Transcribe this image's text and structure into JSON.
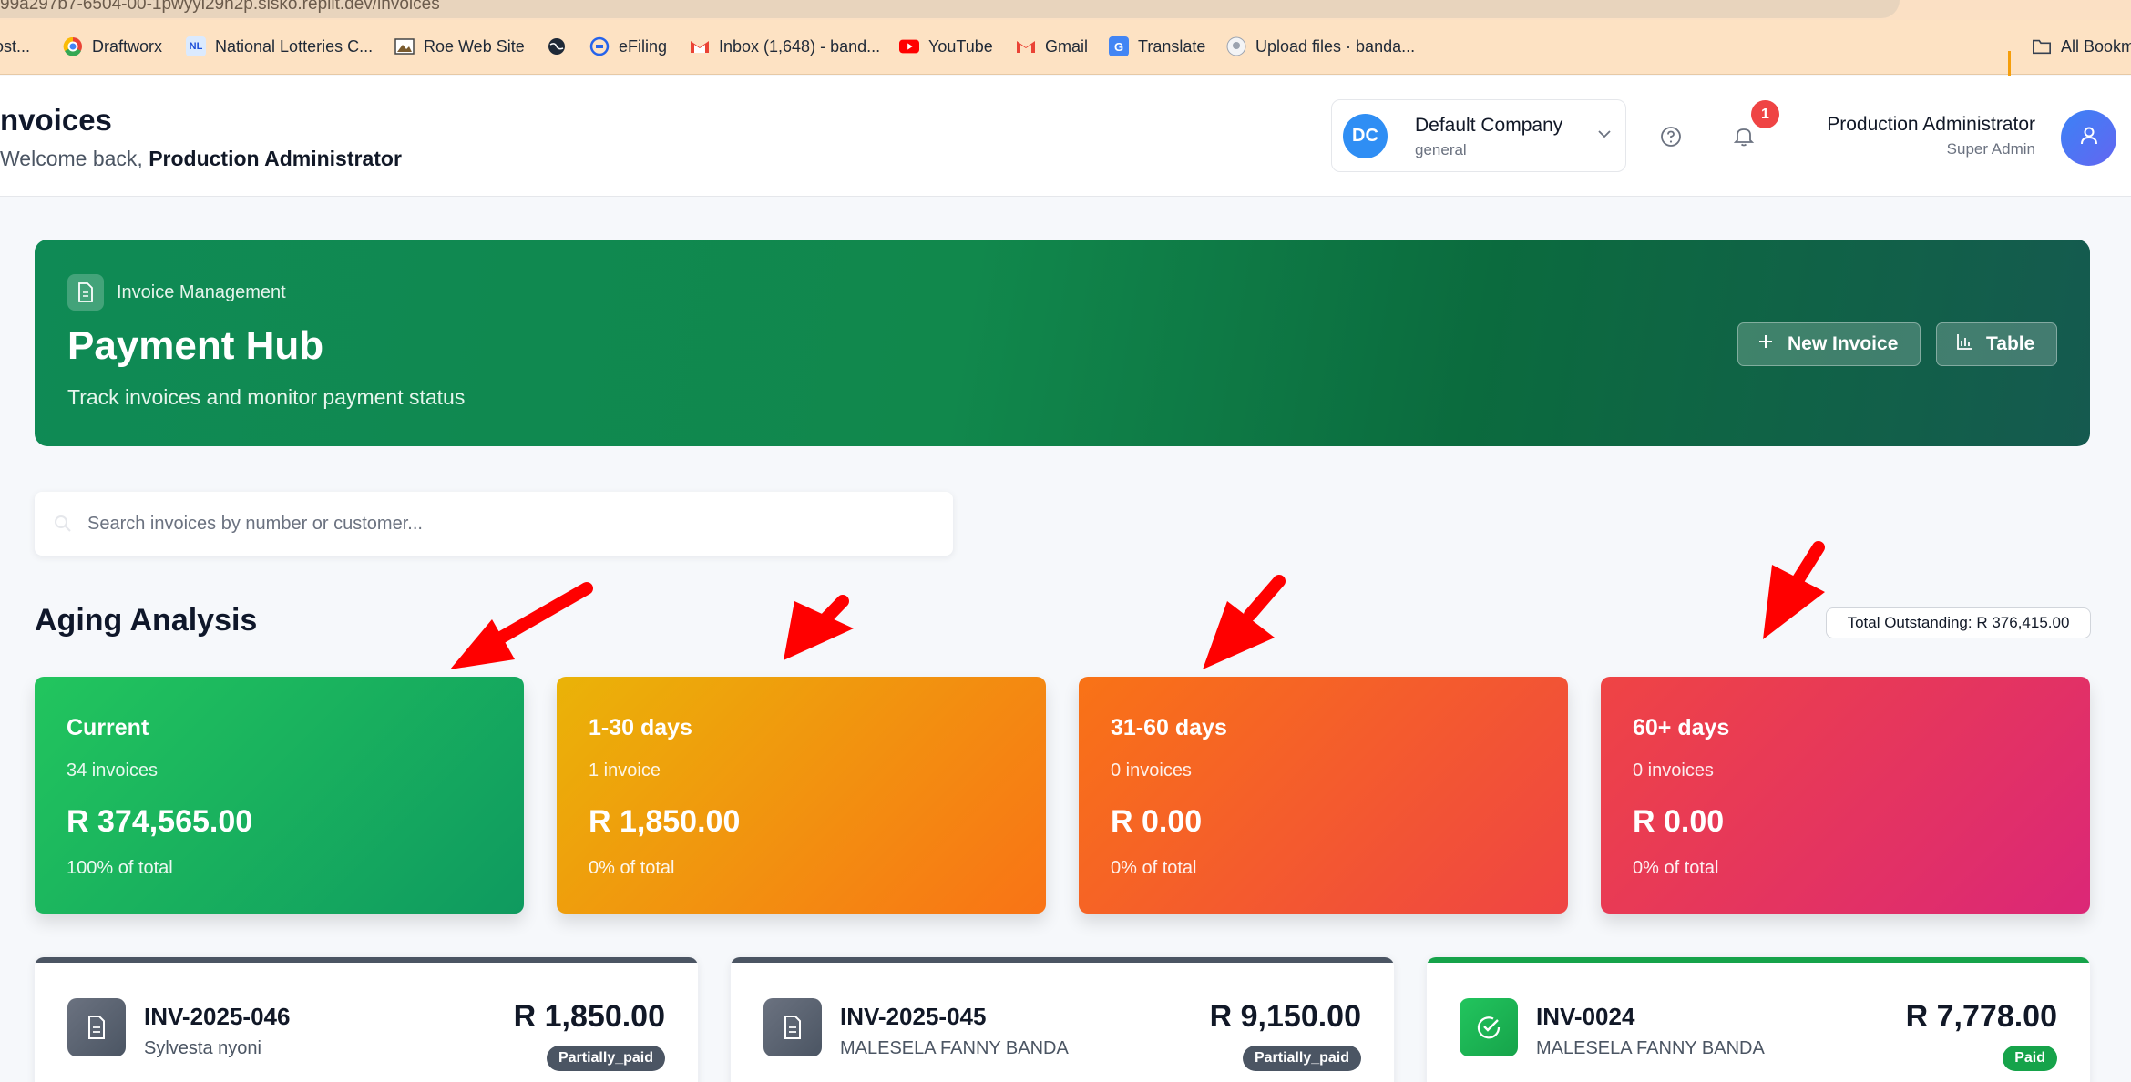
{
  "browser": {
    "url": "99a297b7-6504-00-1pwyyl29h2p.sisko.replit.dev/invoices",
    "bookmarks": [
      {
        "label": "ost...",
        "icon": "bookmark-icon"
      },
      {
        "label": "Draftworx",
        "icon": "chrome-icon"
      },
      {
        "label": "National Lotteries C...",
        "icon": "lotteries-icon"
      },
      {
        "label": "Roe Web Site",
        "icon": "picture-icon"
      },
      {
        "label": "",
        "icon": "globe-icon"
      },
      {
        "label": "eFiling",
        "icon": "efiling-icon"
      },
      {
        "label": "Inbox (1,648) - band...",
        "icon": "gmail-icon"
      },
      {
        "label": "YouTube",
        "icon": "youtube-icon"
      },
      {
        "label": "Gmail",
        "icon": "gmail-icon"
      },
      {
        "label": "Translate",
        "icon": "translate-icon"
      },
      {
        "label": "Upload files · banda...",
        "icon": "github-icon"
      }
    ],
    "all_bookmarks": "All Bookm"
  },
  "header": {
    "title": "nvoices",
    "welcome_prefix": "Welcome back, ",
    "welcome_user": "Production Administrator",
    "company": {
      "initials": "DC",
      "name": "Default Company",
      "sub": "general"
    },
    "notifications": "1",
    "user": {
      "name": "Production Administrator",
      "role": "Super Admin"
    }
  },
  "hero": {
    "tag": "Invoice Management",
    "title": "Payment Hub",
    "subtitle": "Track invoices and monitor payment status",
    "new_invoice": "New Invoice",
    "table": "Table"
  },
  "search": {
    "placeholder": "Search invoices by number or customer..."
  },
  "aging": {
    "title": "Aging Analysis",
    "total_outstanding": "Total Outstanding: R 376,415.00",
    "buckets": [
      {
        "title": "Current",
        "count": "34 invoices",
        "amount": "R 374,565.00",
        "pct": "100% of total"
      },
      {
        "title": "1-30 days",
        "count": "1 invoice",
        "amount": "R 1,850.00",
        "pct": "0% of total"
      },
      {
        "title": "31-60 days",
        "count": "0 invoices",
        "amount": "R 0.00",
        "pct": "0% of total"
      },
      {
        "title": "60+ days",
        "count": "0 invoices",
        "amount": "R 0.00",
        "pct": "0% of total"
      }
    ]
  },
  "invoices": [
    {
      "number": "INV-2025-046",
      "customer": "Sylvesta nyoni",
      "amount": "R 1,850.00",
      "status": "Partially_paid"
    },
    {
      "number": "INV-2025-045",
      "customer": "MALESELA FANNY BANDA",
      "amount": "R 9,150.00",
      "status": "Partially_paid"
    },
    {
      "number": "INV-0024",
      "customer": "MALESELA FANNY BANDA",
      "amount": "R 7,778.00",
      "status": "Paid"
    }
  ],
  "colors": {
    "brand_green": "#0f8a55",
    "annotation_arrow": "#ff0000",
    "badge_red": "#ef4444"
  }
}
